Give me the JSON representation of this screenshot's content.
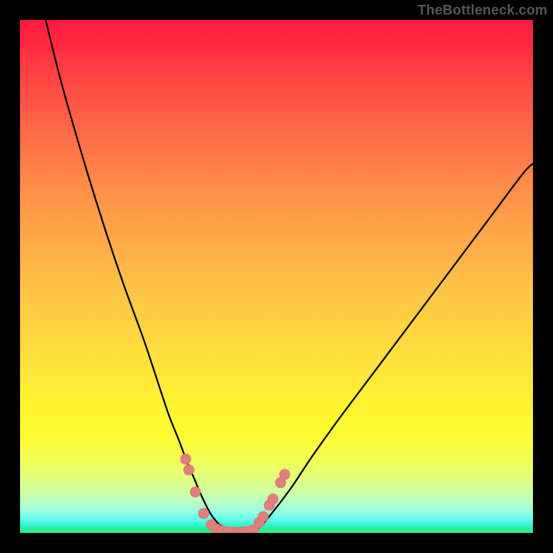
{
  "watermark": "TheBottleneck.com",
  "colors": {
    "background": "#000000",
    "curve": "#000000",
    "marker_fill": "#e07f7b",
    "marker_stroke": "#d46d68"
  },
  "chart_data": {
    "type": "line",
    "title": "",
    "xlabel": "",
    "ylabel": "",
    "xlim": [
      0,
      100
    ],
    "ylim": [
      0,
      100
    ],
    "grid": false,
    "legend": false,
    "series": [
      {
        "name": "left-curve",
        "x": [
          5,
          8,
          12,
          16,
          20,
          24,
          27,
          29,
          31,
          32.5,
          34,
          35.5,
          37,
          38.5,
          40,
          41
        ],
        "y": [
          100,
          88,
          74,
          61,
          49,
          38,
          29,
          23,
          18,
          14,
          10.5,
          7,
          4,
          2,
          0.7,
          0.2
        ]
      },
      {
        "name": "right-curve",
        "x": [
          45,
          46.5,
          48,
          50,
          53,
          57,
          62,
          68,
          74,
          80,
          86,
          92,
          98,
          100
        ],
        "y": [
          0.2,
          1,
          2.5,
          5,
          9,
          15,
          22,
          30,
          38,
          46,
          54,
          62,
          70,
          72
        ]
      },
      {
        "name": "markers-left",
        "x": [
          32.3,
          32.9,
          34.2,
          35.8,
          37.3
        ],
        "y": [
          14.4,
          12.3,
          8.0,
          3.8,
          1.6
        ]
      },
      {
        "name": "markers-bottom",
        "x": [
          38.3,
          39.4,
          40.5,
          41.6,
          42.7,
          43.5,
          44.5,
          45.5
        ],
        "y": [
          0.8,
          0.4,
          0.2,
          0.15,
          0.15,
          0.18,
          0.3,
          0.6
        ]
      },
      {
        "name": "markers-right",
        "x": [
          46.6,
          47.4,
          48.6,
          49.3,
          50.8,
          51.6
        ],
        "y": [
          2.0,
          3.2,
          5.4,
          6.6,
          9.8,
          11.4
        ]
      }
    ]
  }
}
